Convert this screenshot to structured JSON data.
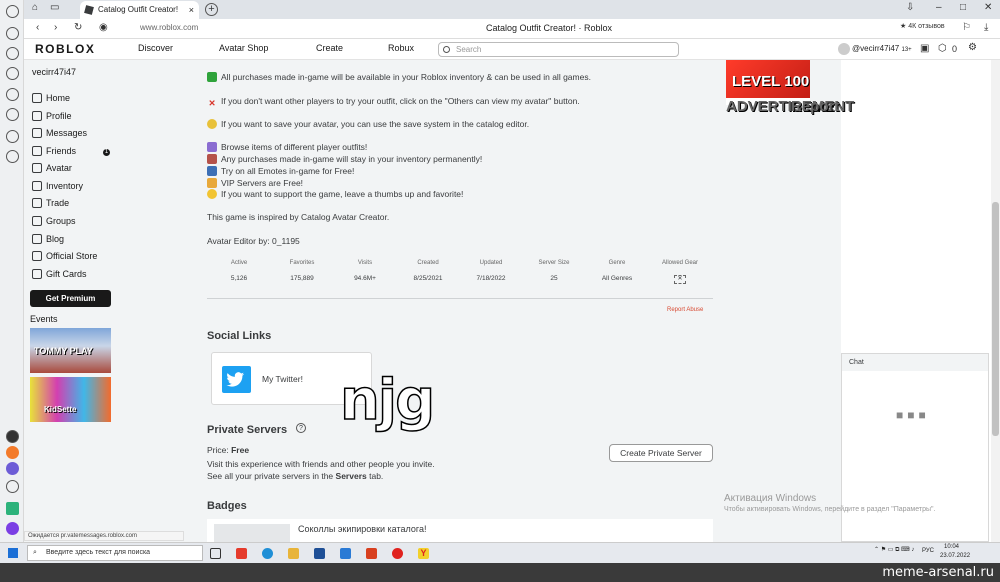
{
  "browser": {
    "tab_title": "Catalog Outfit Creator!",
    "url": "www.roblox.com",
    "page_title": "Catalog Outfit Creator! · Roblox",
    "reviews": "4К отзывов"
  },
  "nav": {
    "logo": "ROBLOX",
    "links": [
      "Discover",
      "Avatar Shop",
      "Create",
      "Robux"
    ],
    "search_placeholder": "Search",
    "user": "@vecirr47i47",
    "age": "13+",
    "robux": "0",
    "notif_count": "1"
  },
  "sidebar": {
    "username": "vecirr47i47",
    "items": [
      "Home",
      "Profile",
      "Messages",
      "Friends",
      "Avatar",
      "Inventory",
      "Trade",
      "Groups",
      "Blog",
      "Official Store",
      "Gift Cards"
    ],
    "friends_badge": "1",
    "premium": "Get Premium",
    "events_label": "Events",
    "event1": "TOMMY PLAY",
    "event2": "KidSette"
  },
  "description": {
    "line1": "All purchases made in-game will be available in your Roblox inventory & can be used in all games.",
    "line2": "If you don't want other players to try your outfit, click on the \"Others can view my avatar\" button.",
    "line3": "If you want to save your avatar, you can use the save system in the catalog editor.",
    "line4": "Browse items of different player outfits!",
    "line5": "Any purchases made in-game will stay in your inventory permanently!",
    "line6": "Try on all Emotes in-game for Free!",
    "line7": "VIP Servers are Free!",
    "line8": "If you want to support the game, leave a thumbs up and favorite!",
    "line9": "This game is inspired by Catalog Avatar Creator.",
    "line10": "Avatar Editor by: 0_1195"
  },
  "stats": {
    "headers": [
      "Active",
      "Favorites",
      "Visits",
      "Created",
      "Updated",
      "Server Size",
      "Genre",
      "Allowed Gear"
    ],
    "values": [
      "5,126",
      "175,889",
      "94.6M+",
      "8/25/2021",
      "7/18/2022",
      "25",
      "All Genres",
      ""
    ]
  },
  "report_abuse": "Report Abuse",
  "social": {
    "heading": "Social Links",
    "link": "My Twitter!"
  },
  "private_servers": {
    "heading": "Private Servers",
    "price_label": "Price:",
    "price_value": "Free",
    "desc1": "Visit this experience with friends and other people you invite.",
    "desc2_pre": "See all your private servers in the",
    "desc2_link": "Servers",
    "desc2_post": "tab.",
    "button": "Create Private Server"
  },
  "badges": {
    "heading": "Badges",
    "item": "Соколлы экипировки каталога!"
  },
  "ad": {
    "text": "LEVEL 100",
    "foot_left": "ADVERTISEMENT",
    "foot_right": "Report"
  },
  "chat": {
    "title": "Chat"
  },
  "windows": {
    "activate_title": "Активация Windows",
    "activate_text": "Чтобы активировать Windows, перейдите в раздел \"Параметры\".",
    "status_url": "Ожидается pr.vatemessages.roblox.com",
    "taskbar_search": "Введите здесь текст для поиска",
    "lang": "РУС",
    "time": "10:04",
    "date": "23.07.2022"
  },
  "overlay_text": "njg",
  "site_watermark": "meme-arsenal.ru",
  "colors": {
    "accent": "#d84a32",
    "twitter": "#1da1f2",
    "ad_red": "#e02a1c",
    "checkmark": "#2fa33b"
  }
}
